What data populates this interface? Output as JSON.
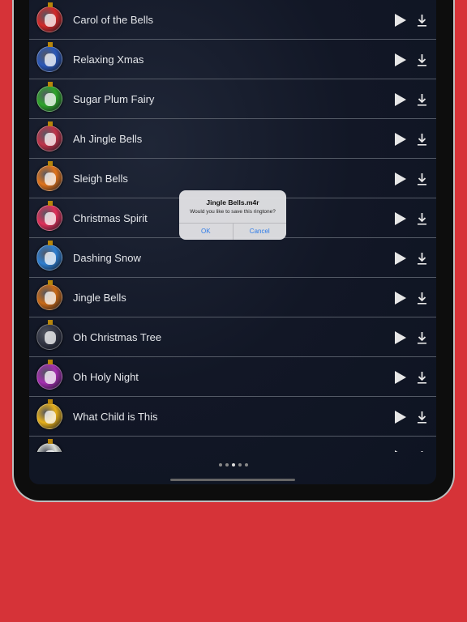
{
  "ringtones": [
    {
      "title": "Carol of the Bells",
      "color": "#d32a2a"
    },
    {
      "title": "Relaxing Xmas",
      "color": "#2b58b8"
    },
    {
      "title": "Sugar Plum Fairy",
      "color": "#2fa52a"
    },
    {
      "title": "Ah Jingle Bells",
      "color": "#c0344a"
    },
    {
      "title": "Sleigh Bells",
      "color": "#e0741c"
    },
    {
      "title": "Christmas Spirit",
      "color": "#e0305a"
    },
    {
      "title": "Dashing Snow",
      "color": "#2f7fd0"
    },
    {
      "title": "Jingle Bells",
      "color": "#c96a18"
    },
    {
      "title": "Oh Christmas Tree",
      "color": "#333644"
    },
    {
      "title": "Oh Holy Night",
      "color": "#a52fb0"
    },
    {
      "title": "What Child is This",
      "color": "#e6b01c"
    },
    {
      "title": "",
      "color": "#d8dcd6"
    }
  ],
  "icons": {
    "play": "play-icon",
    "download": "download-icon"
  },
  "alert": {
    "title": "Jingle Bells.m4r",
    "message": "Would you like to save this ringtone?",
    "ok": "OK",
    "cancel": "Cancel"
  },
  "page_indicator": {
    "pages": 5,
    "current": 3
  }
}
